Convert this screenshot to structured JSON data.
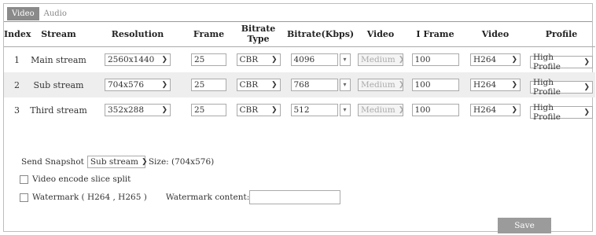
{
  "tabs": [
    "Video",
    "Audio"
  ],
  "columns": [
    "Index",
    "Stream",
    "Resolution",
    "Frame",
    "Bitrate Type",
    "Bitrate(Kbps)",
    "Video",
    "I Frame",
    "Video",
    "Profile"
  ],
  "rows": [
    {
      "index": "1",
      "stream": "Main stream",
      "resolution": "2560x1440",
      "frame": "25",
      "bitrate_type": "CBR",
      "bitrate": "4096",
      "video_quality": "Medium",
      "i_frame": "100",
      "encode": "H264",
      "profile": "High Profile"
    },
    {
      "index": "2",
      "stream": "Sub stream",
      "resolution": "704x576",
      "frame": "25",
      "bitrate_type": "CBR",
      "bitrate": "768",
      "video_quality": "Medium",
      "i_frame": "100",
      "encode": "H264",
      "profile": "High Profile"
    },
    {
      "index": "3",
      "stream": "Third stream",
      "resolution": "352x288",
      "frame": "25",
      "bitrate_type": "CBR",
      "bitrate": "512",
      "video_quality": "Medium",
      "i_frame": "100",
      "encode": "H264",
      "profile": "High Profile"
    }
  ],
  "snapshot": {
    "label": "Send Snapshot",
    "value": "Sub stream",
    "size_label": "Size: (704x576)"
  },
  "slice_split_label": "Video encode slice split",
  "watermark": {
    "label": "Watermark ( H264 , H265 )",
    "content_label": "Watermark content:",
    "content_value": ""
  },
  "save_label": "Save"
}
